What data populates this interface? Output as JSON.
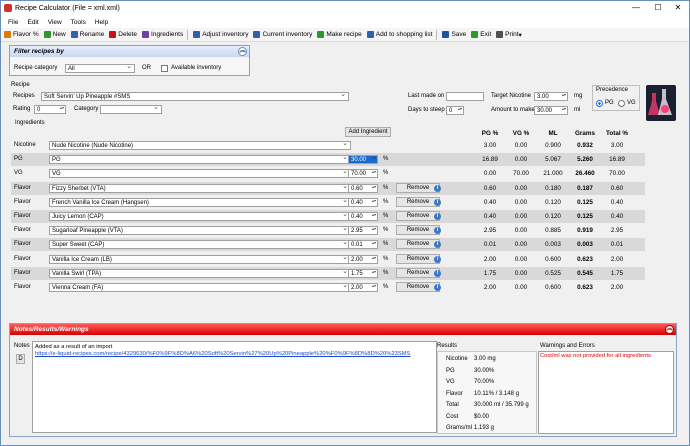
{
  "window": {
    "title": "Recipe Calculator (File = xml.xml)",
    "minimize": "—",
    "maximize": "☐",
    "close": "✕"
  },
  "menu": [
    "File",
    "Edit",
    "View",
    "Tools",
    "Help"
  ],
  "toolbar": [
    {
      "label": "Flavor %",
      "icon": "flavor-icon",
      "color": "#e07b00"
    },
    {
      "label": "New",
      "icon": "plus-icon",
      "color": "#2a9a2a"
    },
    {
      "label": "Rename",
      "icon": "rename-icon",
      "color": "#3060b0"
    },
    {
      "label": "Delete",
      "icon": "delete-icon",
      "color": "#d01010"
    },
    {
      "label": "Ingredients",
      "icon": "ingredients-icon",
      "color": "#7040a0"
    },
    {
      "label": "Adjust inventory",
      "icon": "adjust-icon",
      "color": "#3060b0"
    },
    {
      "label": "Current inventory",
      "icon": "inventory-icon",
      "color": "#3060b0"
    },
    {
      "label": "Make recipe",
      "icon": "make-icon",
      "color": "#2a9a2a"
    },
    {
      "label": "Add to shopping list",
      "icon": "cart-icon",
      "color": "#3060b0"
    },
    {
      "label": "Save",
      "icon": "save-icon",
      "color": "#2050a0"
    },
    {
      "label": "Exit",
      "icon": "exit-icon",
      "color": "#2a9a2a"
    },
    {
      "label": "Print",
      "icon": "print-icon",
      "color": "#505050"
    }
  ],
  "filter": {
    "title": "Filter recipes by",
    "category_label": "Recipe category",
    "category_value": "All",
    "or": "OR",
    "available_label": "Available inventory"
  },
  "recipe": {
    "group": "Recipe",
    "recipes_label": "Recipes",
    "recipes_value": "Soft Servin' Up Pineapple #SMS",
    "rating_label": "Rating",
    "rating_value": "0",
    "category_label": "Category",
    "category_value": "",
    "last_made_label": "Last made on",
    "last_made_value": "",
    "target_nic_label": "Target Nicotine",
    "target_nic_value": "3.00",
    "target_nic_unit": "mg",
    "steep_label": "Days to steep",
    "steep_value": "0",
    "amount_label": "Amount to make",
    "amount_value": "30.00",
    "amount_unit": "ml",
    "precedence_label": "Precedence",
    "pg_option": "PG",
    "vg_option": "VG"
  },
  "ingredients": {
    "group": "Ingredients",
    "add_button": "Add Ingredient",
    "headers": [
      "PG %",
      "VG %",
      "ML",
      "Grams",
      "Total %"
    ],
    "remove_label": "Remove",
    "percent": "%",
    "rows": [
      {
        "type": "Nicotine",
        "name": "Nude Nicotine (Nude Nicotine)",
        "value": "",
        "pct": "",
        "remove": false,
        "pg": "3.00",
        "vg": "0.00",
        "ml": "0.900",
        "grams": "0.932",
        "total": "3.00"
      },
      {
        "type": "PG",
        "name": "PG",
        "value": "30.00",
        "pct": "%",
        "remove": false,
        "pg": "16.89",
        "vg": "0.00",
        "ml": "5.067",
        "grams": "5.260",
        "total": "16.89"
      },
      {
        "type": "VG",
        "name": "VG",
        "value": "70.00",
        "pct": "%",
        "remove": false,
        "pg": "0.00",
        "vg": "70.00",
        "ml": "21.000",
        "grams": "26.460",
        "total": "70.00"
      },
      {
        "type": "Flavor",
        "name": "Fizzy Sherbet (VTA)",
        "value": "0.60",
        "pct": "%",
        "remove": true,
        "pg": "0.60",
        "vg": "0.00",
        "ml": "0.180",
        "grams": "0.187",
        "total": "0.60"
      },
      {
        "type": "Flavor",
        "name": "French Vanilla Ice Cream (Hangsen)",
        "value": "0.40",
        "pct": "%",
        "remove": true,
        "pg": "0.40",
        "vg": "0.00",
        "ml": "0.120",
        "grams": "0.125",
        "total": "0.40"
      },
      {
        "type": "Flavor",
        "name": "Juicy Lemon (CAP)",
        "value": "0.40",
        "pct": "%",
        "remove": true,
        "pg": "0.40",
        "vg": "0.00",
        "ml": "0.120",
        "grams": "0.125",
        "total": "0.40"
      },
      {
        "type": "Flavor",
        "name": "Sugarloaf Pineapple (VTA)",
        "value": "2.95",
        "pct": "%",
        "remove": true,
        "pg": "2.95",
        "vg": "0.00",
        "ml": "0.885",
        "grams": "0.919",
        "total": "2.95"
      },
      {
        "type": "Flavor",
        "name": "Super Sweet (CAP)",
        "value": "0.01",
        "pct": "%",
        "remove": true,
        "pg": "0.01",
        "vg": "0.00",
        "ml": "0.003",
        "grams": "0.003",
        "total": "0.01"
      },
      {
        "type": "Flavor",
        "name": "Vanilla Ice Cream (LB)",
        "value": "2.00",
        "pct": "%",
        "remove": true,
        "pg": "2.00",
        "vg": "0.00",
        "ml": "0.600",
        "grams": "0.623",
        "total": "2.00"
      },
      {
        "type": "Flavor",
        "name": "Vanilla Swirl (TPA)",
        "value": "1.75",
        "pct": "%",
        "remove": true,
        "pg": "1.75",
        "vg": "0.00",
        "ml": "0.525",
        "grams": "0.545",
        "total": "1.75"
      },
      {
        "type": "Flavor",
        "name": "Vienna Cream (FA)",
        "value": "2.00",
        "pct": "%",
        "remove": true,
        "pg": "2.00",
        "vg": "0.00",
        "ml": "0.600",
        "grams": "0.623",
        "total": "2.00"
      }
    ]
  },
  "notes": {
    "header": "Notes/Results/Warnings",
    "notes_label": "Notes",
    "d_button": "D",
    "note_line1": "Added as a result of an import",
    "note_link": "https://e-liquid-recipes.com/recipe/4329630/%F0%9F%8D%A6%20Soft%20Servin%27%20Up%20Pineapple%20%F0%9F%8D%8D%20%23SMS",
    "results_label": "Results",
    "results": [
      {
        "k": "Nicotine",
        "v": "3.00 mg"
      },
      {
        "k": "PG",
        "v": "30.00%"
      },
      {
        "k": "VG",
        "v": "70.00%"
      },
      {
        "k": "Flavor",
        "v": "10.11% / 3.148 g"
      },
      {
        "k": "Total",
        "v": "30.000 ml / 35.799 g"
      },
      {
        "k": "Cost",
        "v": "$0.00"
      },
      {
        "k": "Grams/ml",
        "v": "1.193 g"
      }
    ],
    "warnings_label": "Warnings and Errors",
    "warning_text": "Cost/ml was not provided for all ingredients"
  }
}
